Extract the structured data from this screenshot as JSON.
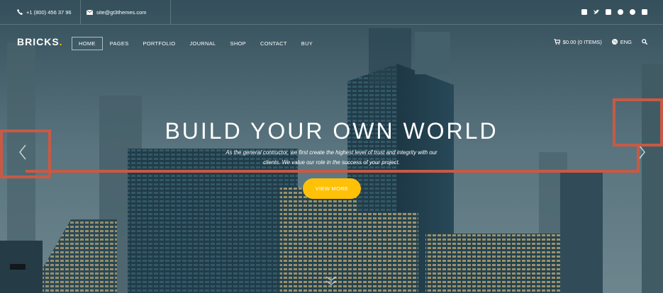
{
  "topbar": {
    "phone": "+1 (800) 456 37 96",
    "email": "site@gt3themes.com",
    "social_icons": [
      "facebook-icon",
      "twitter-icon",
      "instagram-icon",
      "dribbble-icon",
      "pinterest-icon",
      "flickr-icon"
    ]
  },
  "header": {
    "logo": "BRICKS",
    "logo_dot": ".",
    "nav": [
      "HOME",
      "PAGES",
      "PORTFOLIO",
      "JOURNAL",
      "SHOP",
      "CONTACT",
      "BUY"
    ],
    "active_nav": "HOME",
    "cart": "$0.00 (0 ITEMS)",
    "language": "ENG"
  },
  "hero": {
    "title": "BUILD YOUR OWN WORLD",
    "subtitle_line1": "As the general contructor, we first create the highest level of trust and integrity with our",
    "subtitle_line2": "clients. We value our role in the success of your project.",
    "button": "VIEW MORE"
  },
  "colors": {
    "accent": "#ffc107",
    "logo_dot": "#f5c400",
    "highlight": "#c85a45"
  }
}
